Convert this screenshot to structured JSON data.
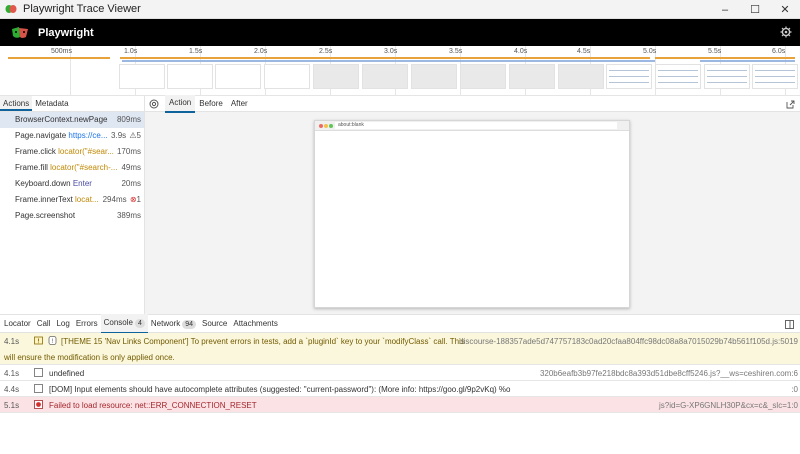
{
  "window": {
    "title": "Playwright Trace Viewer",
    "minimize": "–",
    "maximize": "☐",
    "close": "✕"
  },
  "appbar": {
    "title": "Playwright"
  },
  "timeline": {
    "ticks": [
      "500ms",
      "1.0s",
      "1.5s",
      "2.0s",
      "2.5s",
      "3.0s",
      "3.5s",
      "4.0s",
      "4.5s",
      "5.0s",
      "5.5s",
      "6.0s"
    ]
  },
  "left_tabs": {
    "actions": "Actions",
    "metadata": "Metadata"
  },
  "actions": [
    {
      "name": "BrowserContext.newPage",
      "param": "",
      "duration": "809ms"
    },
    {
      "name": "Page.navigate",
      "param": "https://ce...",
      "duration": "3.9s",
      "badge": "5"
    },
    {
      "name": "Frame.click",
      "param": "locator(\"#sear...",
      "duration": "170ms"
    },
    {
      "name": "Frame.fill",
      "param": "locator(\"#search-...",
      "duration": "49ms"
    },
    {
      "name": "Keyboard.down",
      "param": "Enter",
      "duration": "20ms"
    },
    {
      "name": "Frame.innerText",
      "param": "locat...",
      "duration": "294ms",
      "badge": "1"
    },
    {
      "name": "Page.screenshot",
      "param": "",
      "duration": "389ms"
    }
  ],
  "right_tabs": {
    "action": "Action",
    "before": "Before",
    "after": "After"
  },
  "snapshot": {
    "url": "about:blank"
  },
  "bottom_tabs": {
    "locator": "Locator",
    "call": "Call",
    "log": "Log",
    "errors": "Errors",
    "console": "Console",
    "console_count": "4",
    "network": "Network",
    "network_count": "94",
    "source": "Source",
    "attachments": "Attachments"
  },
  "console": [
    {
      "time": "4.1s",
      "message": "[THEME 15 'Nav Links Component'] To prevent errors in tests, add a `pluginId` key to your `modifyClass` call. This",
      "source": "discourse-188357ade5d747757183c0ad20cfaa804ffc98dc08a8a7015029b74b561f105d.js:5019",
      "message2": "will ensure the modification is only applied once."
    },
    {
      "time": "4.1s",
      "message": "undefined",
      "source": "320b6eafb3b97fe218bdc8a393d51dbe8cff5246.js?__ws=ceshiren.com:6"
    },
    {
      "time": "4.4s",
      "message": "[DOM] Input elements should have autocomplete attributes (suggested: \"current-password\"): (More info: https://goo.gl/9p2vKq) %o",
      "source": ":0"
    },
    {
      "time": "5.1s",
      "message": "Failed to load resource: net::ERR_CONNECTION_RESET",
      "source": "js?id=G-XP6GNLH30P&cx=c&_slc=1:0"
    }
  ]
}
